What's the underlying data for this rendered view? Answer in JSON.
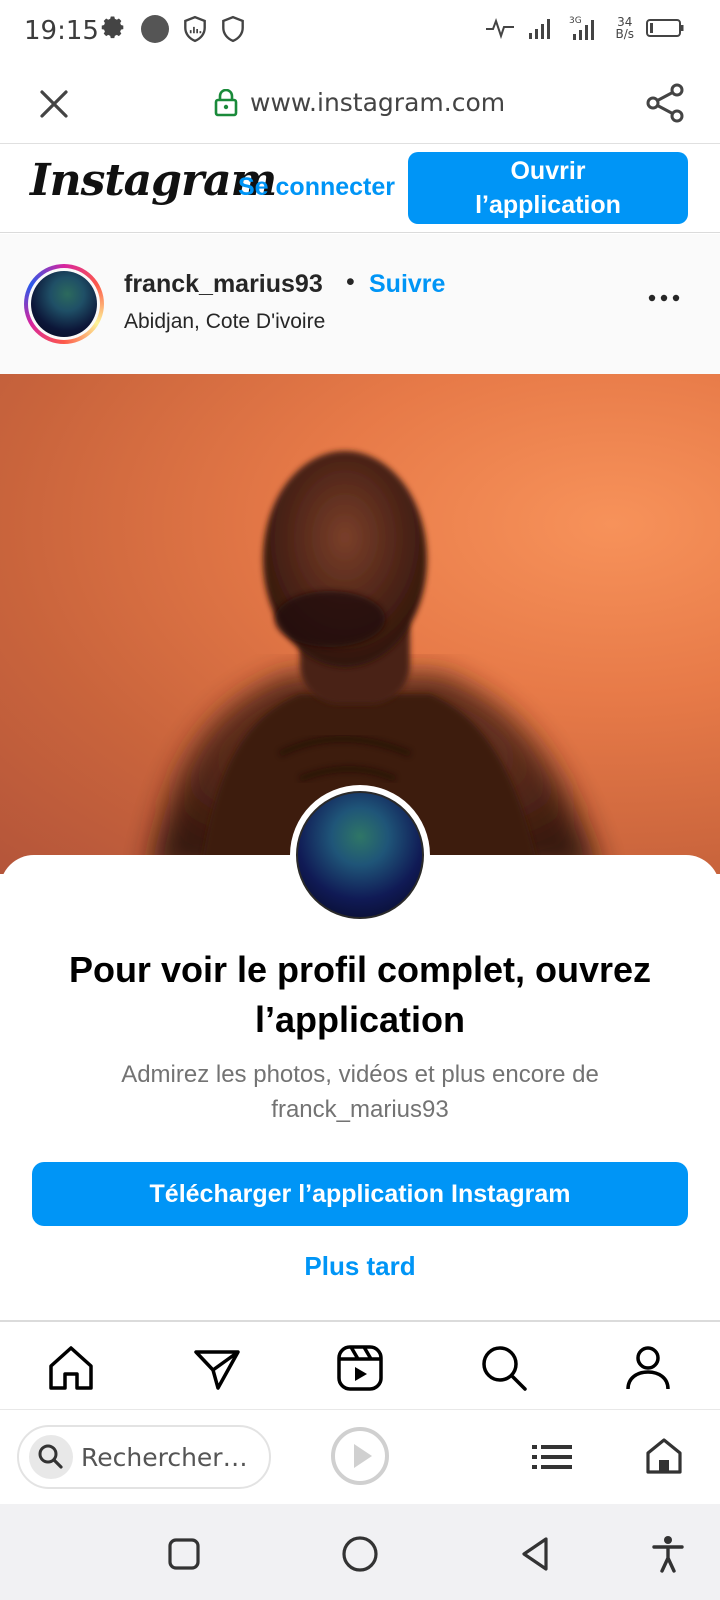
{
  "status_bar": {
    "time": "19:15",
    "network": "3G",
    "speed_value": "34",
    "speed_unit": "B/s"
  },
  "browser": {
    "url": "www.instagram.com",
    "search_placeholder": "Rechercher…"
  },
  "instagram_header": {
    "logo": "Instagram",
    "login_label": "Se connecter",
    "open_app_line1": "Ouvrir",
    "open_app_line2": "l’application"
  },
  "post": {
    "username": "franck_marius93",
    "separator": "•",
    "follow_label": "Suivre",
    "location": "Abidjan, Cote D'ivoire"
  },
  "sheet": {
    "title": "Pour voir le profil complet, ouvrez l’application",
    "description": "Admirez les photos, vidéos et plus encore de franck_marius93",
    "download_label": "Télécharger l’application Instagram",
    "later_label": "Plus tard"
  },
  "colors": {
    "brand_blue": "#0095f6",
    "photo_background": "#e77a48"
  },
  "tab_bar": {
    "icons": [
      "home-icon",
      "direct-message-icon",
      "reels-icon",
      "search-icon",
      "profile-icon"
    ]
  },
  "android_nav": {
    "icons": [
      "recents-square-icon",
      "home-circle-icon",
      "back-triangle-icon",
      "accessibility-icon"
    ]
  }
}
